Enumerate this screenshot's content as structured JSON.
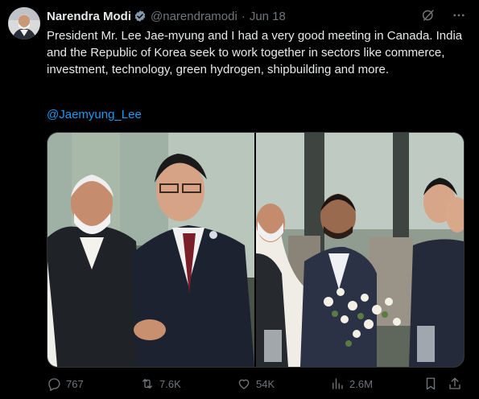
{
  "author": {
    "name": "Narendra Modi",
    "handle": "@narendramodi",
    "date": "Jun 18"
  },
  "post": {
    "text": "President Mr. Lee Jae-myung and I had a very good meeting in Canada. India and the Republic of Korea seek to work together in sectors like commerce, investment, technology, green hydrogen, shipbuilding and more.",
    "mention": "@Jaemyung_Lee"
  },
  "icons": {
    "verified": "verified-badge-icon",
    "grok": "grok-icon",
    "more": "more-icon",
    "reply": "reply-icon",
    "repost": "repost-icon",
    "like": "like-icon",
    "views": "views-icon",
    "bookmark": "bookmark-icon",
    "share": "share-icon"
  },
  "stats": {
    "replies": "767",
    "reposts": "7.6K",
    "likes": "54K",
    "views": "2.6M"
  },
  "colors": {
    "background": "#000000",
    "text": "#e7e9ea",
    "muted": "#71767b",
    "link": "#1d9bf0",
    "border": "#2f3336"
  }
}
